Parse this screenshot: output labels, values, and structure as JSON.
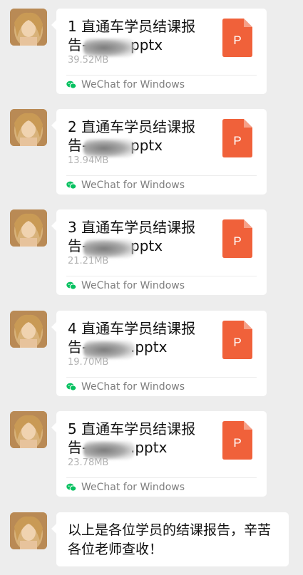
{
  "messages": [
    {
      "title_line1": "1 直通车学员结课报",
      "title_line2": "告-",
      "ext": "pptx",
      "size": "39.52MB",
      "source": "WeChat for Windows",
      "file_icon_letter": "P"
    },
    {
      "title_line1": "2 直通车学员结课报",
      "title_line2": "告-",
      "ext": "pptx",
      "size": "13.94MB",
      "source": "WeChat for Windows",
      "file_icon_letter": "P"
    },
    {
      "title_line1": "3 直通车学员结课报",
      "title_line2": "告-",
      "ext": "pptx",
      "size": "21.21MB",
      "source": "WeChat for Windows",
      "file_icon_letter": "P"
    },
    {
      "title_line1": "4 直通车学员结课报",
      "title_line2": "告-",
      "ext": ".pptx",
      "size": "19.70MB",
      "source": "WeChat for Windows",
      "file_icon_letter": "P"
    },
    {
      "title_line1": "5 直通车学员结课报",
      "title_line2": "告-",
      "ext": ".pptx",
      "size": "23.78MB",
      "source": "WeChat for Windows",
      "file_icon_letter": "P"
    }
  ],
  "final_text": "以上是各位学员的结课报告，辛苦各位老师查收！",
  "colors": {
    "background": "#ededed",
    "bubble": "#ffffff",
    "ppt_icon": "#f0613a",
    "wechat_green": "#07c160"
  },
  "icons": {
    "file": "ppt-file-icon",
    "source": "wechat-icon"
  }
}
